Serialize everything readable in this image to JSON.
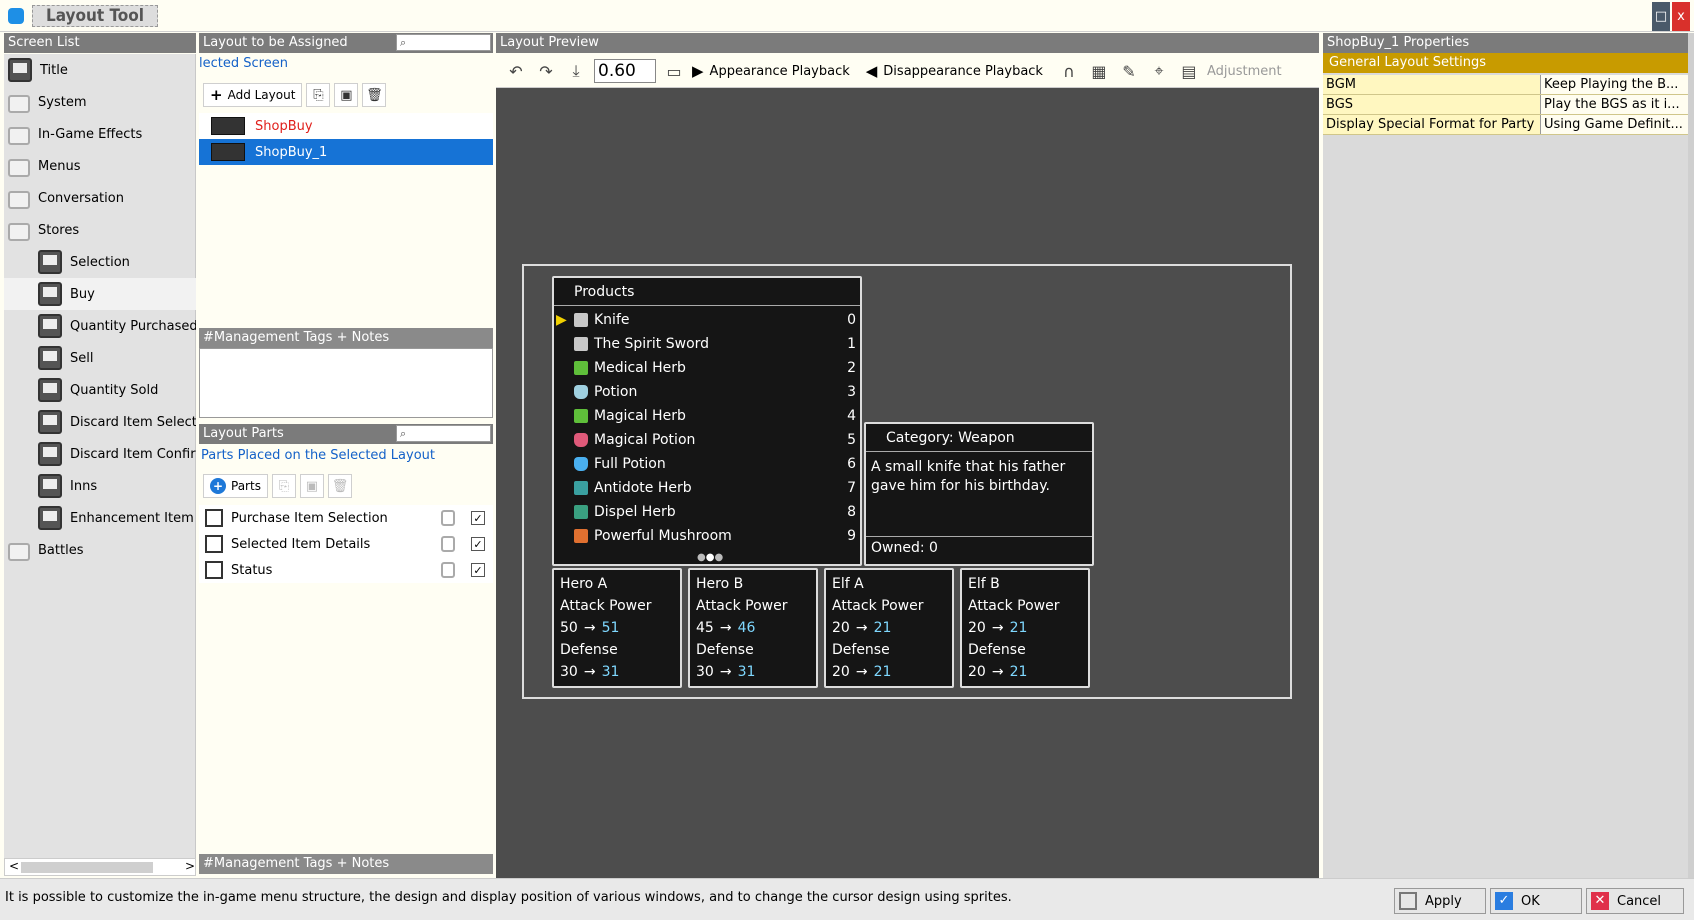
{
  "window": {
    "title": "Layout Tool",
    "restore_icon": "□",
    "close_icon": "x"
  },
  "screen_list": {
    "header": "Screen List",
    "items": [
      {
        "label": "Title",
        "icon": "monitor-icon"
      },
      {
        "label": "System",
        "icon": "folder-icon"
      },
      {
        "label": "In-Game Effects",
        "icon": "folder-icon"
      },
      {
        "label": "Menus",
        "icon": "folder-icon"
      },
      {
        "label": "Conversation",
        "icon": "folder-icon"
      },
      {
        "label": "Stores",
        "icon": "folder-icon"
      },
      {
        "label": "Selection",
        "icon": "monitor-icon"
      },
      {
        "label": "Buy",
        "icon": "monitor-icon"
      },
      {
        "label": "Quantity Purchased",
        "icon": "monitor-icon"
      },
      {
        "label": "Sell",
        "icon": "monitor-icon"
      },
      {
        "label": "Quantity Sold",
        "icon": "monitor-icon"
      },
      {
        "label": "Discard Item Selectio",
        "icon": "monitor-icon"
      },
      {
        "label": "Discard Item Confirm",
        "icon": "monitor-icon"
      },
      {
        "label": "Inns",
        "icon": "monitor-icon"
      },
      {
        "label": "Enhancement Item S",
        "icon": "monitor-icon"
      },
      {
        "label": "Battles",
        "icon": "folder-icon"
      }
    ],
    "selected": "Buy",
    "scroll_left": "<",
    "scroll_right": ">"
  },
  "layout_assign": {
    "header": "Layout to be Assigned",
    "subtitle": "lected Screen",
    "add_label": "Add Layout",
    "layouts": [
      {
        "name": "ShopBuy",
        "color": "#e0201c"
      },
      {
        "name": "ShopBuy_1",
        "color": "#ffffff"
      }
    ],
    "notes_header": "#Management Tags + Notes"
  },
  "layout_parts": {
    "header": "Layout Parts",
    "subtitle": "Parts Placed on the Selected Layout",
    "parts_label": "Parts",
    "parts": [
      "Purchase Item Selection",
      "Selected Item Details",
      "Status"
    ],
    "notes_header": "#Management Tags + Notes"
  },
  "preview": {
    "header": "Layout Preview",
    "zoom": "0.60",
    "appearance": "Appearance Playback",
    "disappearance": "Disappearance Playback",
    "adjustment": "Adjustment"
  },
  "game": {
    "products_title": "Products",
    "products": [
      {
        "name": "Knife",
        "num": "0",
        "icon": "dagger-icon",
        "color": "#c8c8c8"
      },
      {
        "name": "The Spirit Sword",
        "num": "1",
        "icon": "sword-icon",
        "color": "#c8c8c8"
      },
      {
        "name": "Medical Herb",
        "num": "2",
        "icon": "herb-icon",
        "color": "#5fbf3a"
      },
      {
        "name": "Potion",
        "num": "3",
        "icon": "potion-icon",
        "color": "#9fd0e0"
      },
      {
        "name": "Magical Herb",
        "num": "4",
        "icon": "herb-icon",
        "color": "#5fbf3a"
      },
      {
        "name": "Magical Potion",
        "num": "5",
        "icon": "potion-icon",
        "color": "#e05a7a"
      },
      {
        "name": "Full Potion",
        "num": "6",
        "icon": "potion-icon",
        "color": "#4ab0f0"
      },
      {
        "name": "Antidote Herb",
        "num": "7",
        "icon": "herb-icon",
        "color": "#3aa0a0"
      },
      {
        "name": "Dispel Herb",
        "num": "8",
        "icon": "herb-icon",
        "color": "#3aa080"
      },
      {
        "name": "Powerful Mushroom",
        "num": "9",
        "icon": "mushroom-icon",
        "color": "#e07030"
      }
    ],
    "category_title": "Category: Weapon",
    "description": "A small knife that his father gave him for his birthday.",
    "owned": "Owned: 0",
    "heroes": [
      {
        "name": "Hero A",
        "atk_label": "Attack Power",
        "atk_from": "50",
        "atk_to": "51",
        "def_label": "Defense",
        "def_from": "30",
        "def_to": "31"
      },
      {
        "name": "Hero B",
        "atk_label": "Attack Power",
        "atk_from": "45",
        "atk_to": "46",
        "def_label": "Defense",
        "def_from": "30",
        "def_to": "31"
      },
      {
        "name": "Elf A",
        "atk_label": "Attack Power",
        "atk_from": "20",
        "atk_to": "21",
        "def_label": "Defense",
        "def_from": "20",
        "def_to": "21"
      },
      {
        "name": "Elf B",
        "atk_label": "Attack Power",
        "atk_from": "20",
        "atk_to": "21",
        "def_label": "Defense",
        "def_from": "20",
        "def_to": "21"
      }
    ],
    "arrow": "→"
  },
  "properties": {
    "header": "ShopBuy_1 Properties",
    "section": "General Layout Settings",
    "rows": [
      {
        "key": "BGM",
        "value": "Keep Playing the B..."
      },
      {
        "key": "BGS",
        "value": "Play the BGS as it i..."
      },
      {
        "key": "Display Special Format for Party",
        "value": "Using Game Definit..."
      }
    ]
  },
  "status": {
    "text": "It is possible to customize the in-game menu structure, the design and display position of various windows, and to change the cursor design using sprites.",
    "apply": "Apply",
    "ok": "OK",
    "cancel": "Cancel"
  }
}
